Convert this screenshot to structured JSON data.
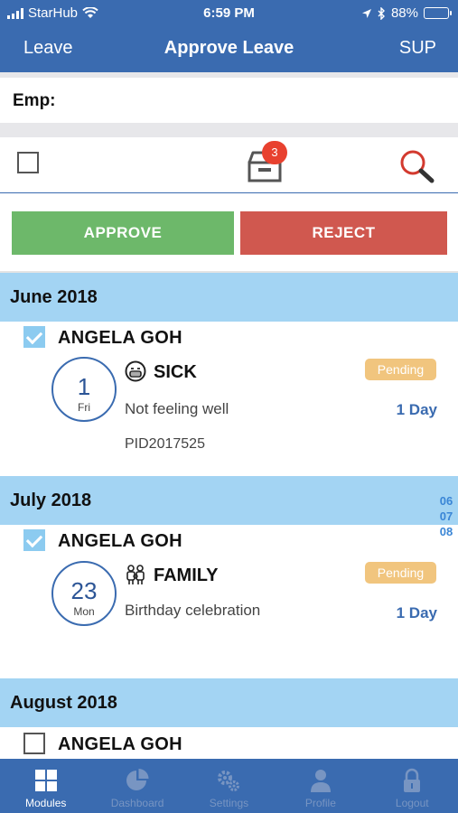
{
  "status_bar": {
    "carrier": "StarHub",
    "time": "6:59 PM",
    "battery": "88%",
    "battery_level": 0.88
  },
  "nav": {
    "back_label": "Leave",
    "title": "Approve Leave",
    "right_label": "SUP"
  },
  "filter": {
    "emp_label": "Emp:"
  },
  "toolbar": {
    "badge_count": "3"
  },
  "actions": {
    "approve_label": "APPROVE",
    "reject_label": "REJECT"
  },
  "groups": [
    {
      "month": "June 2018",
      "entry": {
        "name": "ANGELA GOH",
        "checked": true,
        "day_num": "1",
        "day_name": "Fri",
        "icon": "sick-mask-icon",
        "leave_type": "SICK",
        "status": "Pending",
        "reason": "Not feeling well",
        "duration": "1 Day",
        "pid": "PID2017525"
      }
    },
    {
      "month": "July 2018",
      "entry": {
        "name": "ANGELA GOH",
        "checked": true,
        "day_num": "23",
        "day_name": "Mon",
        "icon": "family-icon",
        "leave_type": "FAMILY",
        "status": "Pending",
        "reason": "Birthday celebration",
        "duration": "1 Day"
      }
    },
    {
      "month": "August 2018",
      "entry": {
        "name": "ANGELA GOH",
        "checked": false
      }
    }
  ],
  "month_index": [
    "06",
    "07",
    "08"
  ],
  "tabs": [
    {
      "label": "Modules",
      "icon": "grid-icon",
      "active": true
    },
    {
      "label": "Dashboard",
      "icon": "pie-chart-icon",
      "active": false
    },
    {
      "label": "Settings",
      "icon": "gears-icon",
      "active": false
    },
    {
      "label": "Profile",
      "icon": "person-icon",
      "active": false
    },
    {
      "label": "Logout",
      "icon": "lock-icon",
      "active": false
    }
  ],
  "colors": {
    "brand": "#3a6bb0",
    "approve": "#6db86a",
    "reject": "#d0584f",
    "month_header": "#a3d4f3",
    "pending": "#f1c57e",
    "badge": "#e8412f",
    "checkbox_checked": "#8ccbf0"
  }
}
